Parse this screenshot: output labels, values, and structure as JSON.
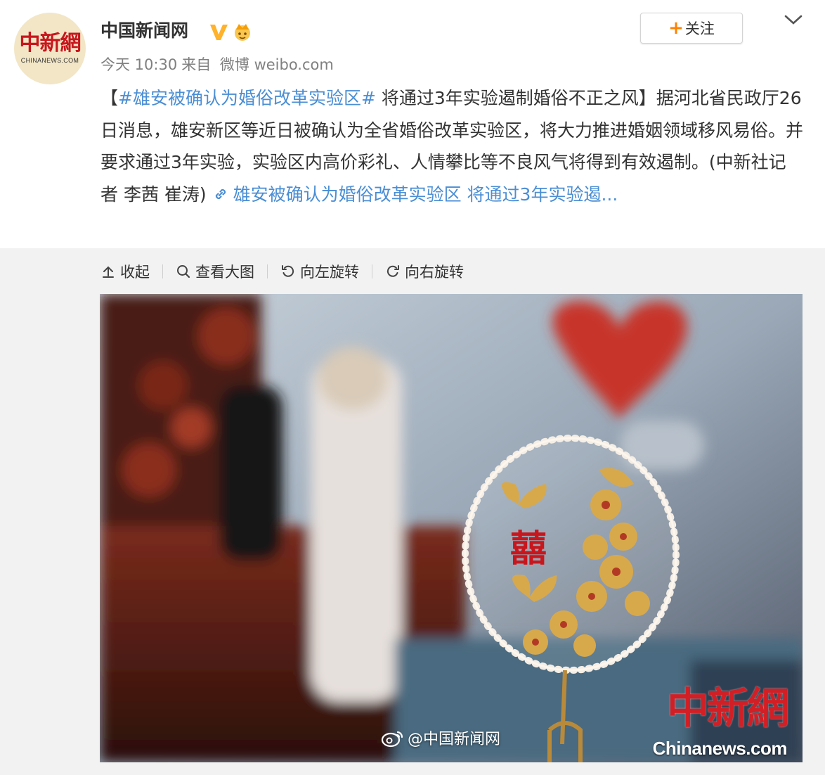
{
  "account": {
    "name": "中国新闻网",
    "avatar_logo_cn": "中新網",
    "avatar_logo_en": "CHINANEWS.COM",
    "verified_icon": "verified-v-icon",
    "badge_icon": "crown-icon"
  },
  "meta": {
    "time": "今天 10:30",
    "source_prefix": "来自",
    "source": "微博 weibo.com"
  },
  "follow_button": {
    "icon": "plus-icon",
    "label": "关注"
  },
  "post": {
    "open_bracket": "【",
    "topic": "#雄安被确认为婚俗改革实验区#",
    "headline": " 将通过3年实验遏制婚俗不正之风】",
    "body": "据河北省民政厅26日消息，雄安新区等近日被确认为全省婚俗改革实验区，将大力推进婚姻领域移风易俗。并要求通过3年实验，实验区内高价彩礼、人情攀比等不良风气将得到有效遏制。(中新社记者 李茜 崔涛) ",
    "link_icon": "link-icon",
    "link_text": "雄安被确认为婚俗改革实验区 将通过3年实验遏..."
  },
  "toolbar": {
    "collapse": "收起",
    "view_large": "查看大图",
    "rotate_left": "向左旋转",
    "rotate_right": "向右旋转"
  },
  "photo": {
    "description_icon": "weibo-icon",
    "watermark_handle": "@中国新闻网",
    "watermark_logo": "中新網",
    "watermark_domain": "Chinanews.com",
    "double_happiness": "囍"
  },
  "colors": {
    "link": "#4a8ed4",
    "follow_plus": "#ff8200",
    "verified": "#ffb22b",
    "brand_red": "#c8161d"
  }
}
